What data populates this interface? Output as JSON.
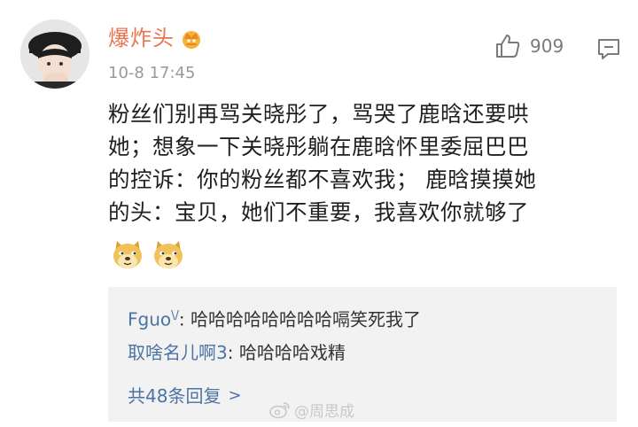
{
  "comment": {
    "username": "爆炸头",
    "timestamp": "10-8 17:45",
    "like_count": "909",
    "text": "粉丝们别再骂关晓彤了，骂哭了鹿晗还要哄\n她；想象一下关晓彤躺在鹿晗怀里委屈巴巴\n的控诉：你的粉丝都不喜欢我；  鹿晗摸摸她\n的头：宝贝，她们不重要，我喜欢你就够了",
    "emojis": [
      "doge-icon",
      "doge-icon"
    ]
  },
  "replies": [
    {
      "name": "Fguo",
      "badge": "\\/",
      "text": ": 哈哈哈哈哈哈哈哈嗝笑死我了"
    },
    {
      "name": "取啥名儿啊3",
      "badge": "",
      "text": ": 哈哈哈哈戏精"
    }
  ],
  "more_replies": "共48条回复",
  "more_arrow": ">",
  "watermark": "@周思成",
  "colors": {
    "username": "#eb7350",
    "link": "#4c73a6",
    "timestamp": "#9a9a9a",
    "reply_bg": "#f2f2f2"
  }
}
